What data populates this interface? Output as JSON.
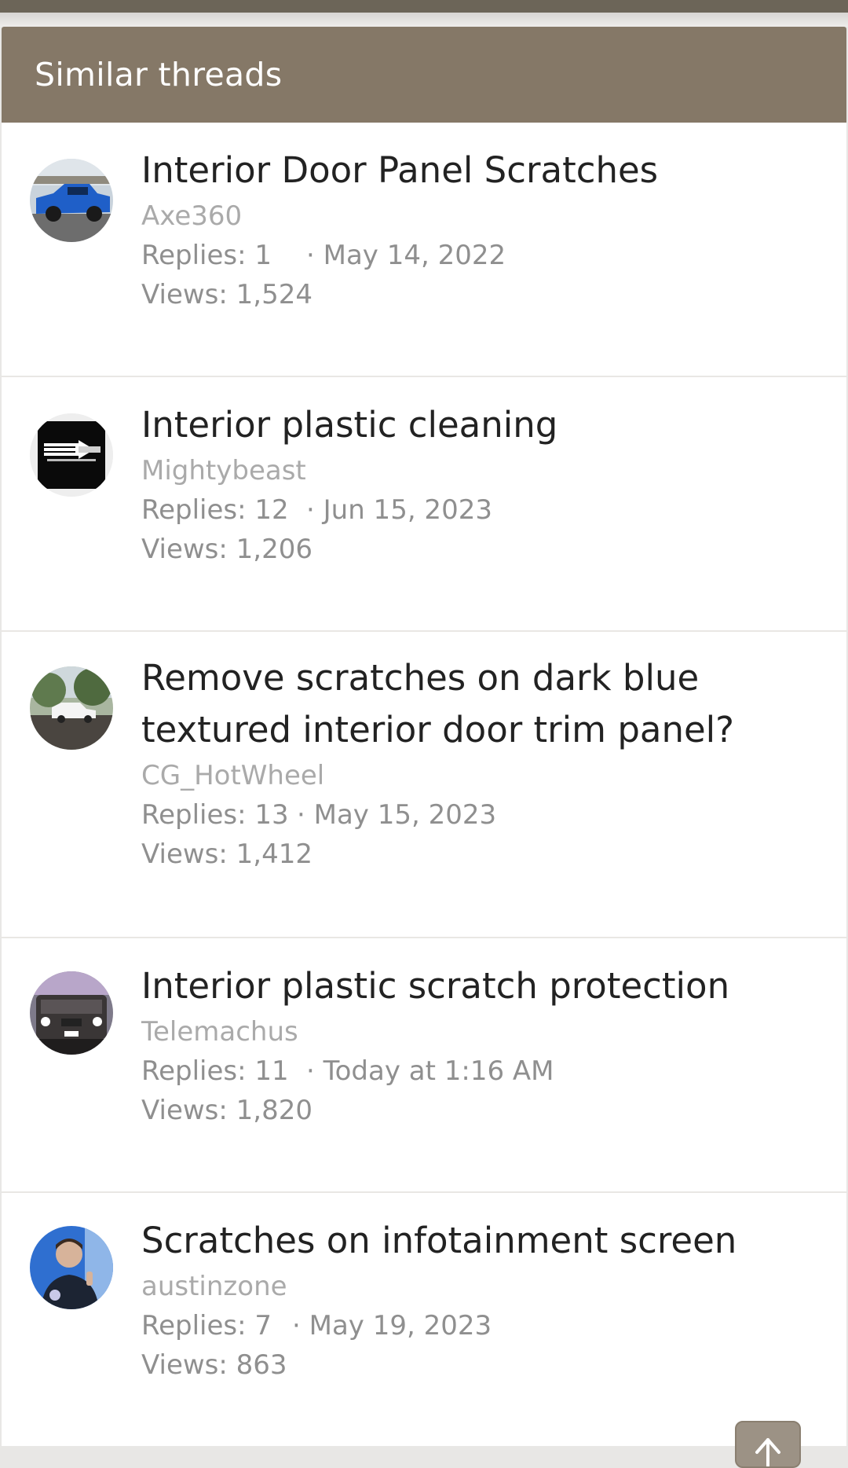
{
  "header": {
    "title": "Similar threads"
  },
  "threads": [
    {
      "title": "Interior Door Panel Scratches",
      "author": "Axe360",
      "replies": "Replies: 1",
      "date": "May 14, 2022",
      "views": "Views: 1,524",
      "avatar": "avatar-blue-truck"
    },
    {
      "title": "Interior plastic cleaning",
      "author": "Mightybeast",
      "replies": "Replies: 12",
      "date": "Jun 15, 2023",
      "views": "Views: 1,206",
      "avatar": "avatar-flag-logo"
    },
    {
      "title": "Remove scratches on dark blue textured interior door trim panel?",
      "author": "CG_HotWheel",
      "replies": "Replies: 13",
      "date": "May 15, 2023",
      "views": "Views: 1,412",
      "avatar": "avatar-white-truck-outdoors"
    },
    {
      "title": "Interior plastic scratch protection",
      "author": "Telemachus",
      "replies": "Replies: 11",
      "date": "Today at 1:16 AM",
      "views": "Views: 1,820",
      "avatar": "avatar-truck-front"
    },
    {
      "title": "Scratches on infotainment screen",
      "author": "austinzone",
      "replies": "Replies: 7",
      "date": "May 19, 2023",
      "views": "Views: 863",
      "avatar": "avatar-person-photo"
    }
  ],
  "dot_separator": "·",
  "colors": {
    "header_bg": "#857867",
    "title": "#222222",
    "author": "#aaaaaa",
    "meta": "#8f8f8f"
  },
  "scroll_top_icon": "arrow-up-icon"
}
